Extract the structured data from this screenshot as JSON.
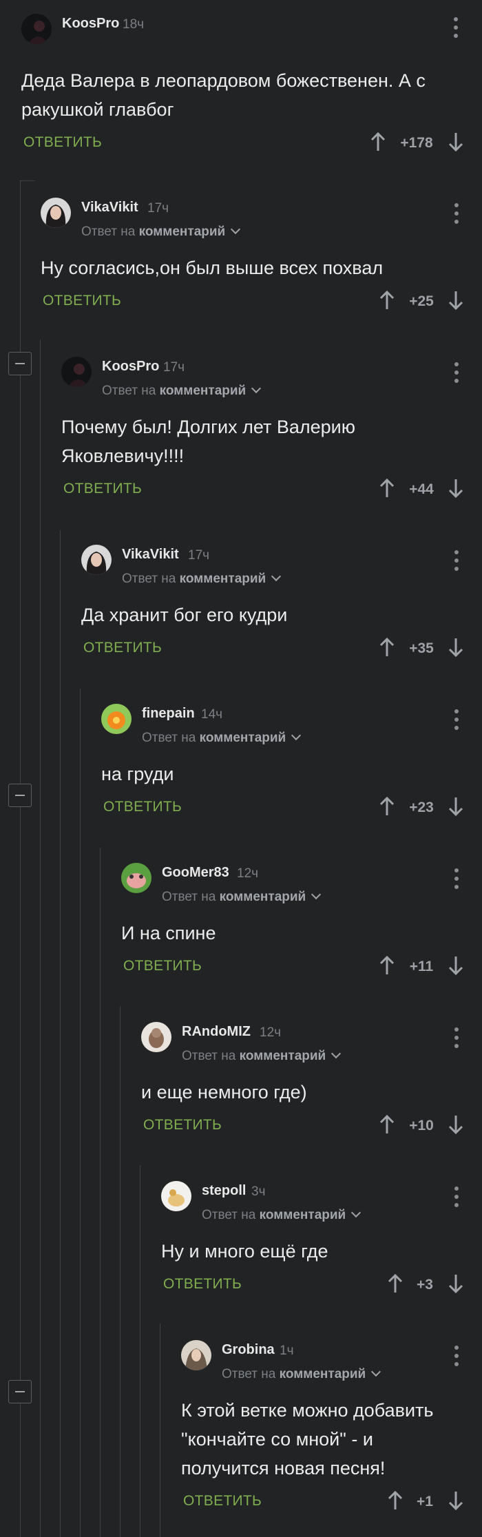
{
  "labels": {
    "answer": "ОТВЕТИТЬ",
    "reply_prefix": "Ответ на",
    "reply_target": "комментарий"
  },
  "comments": [
    {
      "user": "KoosPro",
      "time": "18ч",
      "text_lines": [
        "Деда Валера в леопардовом божественен. А с",
        "ракушкой главбог"
      ],
      "rating": "+178",
      "is_reply": false
    },
    {
      "user": "VikaVikit",
      "time": "17ч",
      "text_lines": [
        "Ну согласись,он был выше всех похвал"
      ],
      "rating": "+25",
      "is_reply": true
    },
    {
      "user": "KoosPro",
      "time": "17ч",
      "text_lines": [
        "Почему был! Долгих лет Валерию",
        "Яковлевичу!!!!"
      ],
      "rating": "+44",
      "is_reply": true
    },
    {
      "user": "VikaVikit",
      "time": "17ч",
      "text_lines": [
        "Да хранит бог его кудри"
      ],
      "rating": "+35",
      "is_reply": true
    },
    {
      "user": "finepain",
      "time": "14ч",
      "text_lines": [
        "на груди"
      ],
      "rating": "+23",
      "is_reply": true
    },
    {
      "user": "GooMer83",
      "time": "12ч",
      "text_lines": [
        "И на спине"
      ],
      "rating": "+11",
      "is_reply": true
    },
    {
      "user": "RAndoMIZ",
      "time": "12ч",
      "text_lines": [
        "и еще немного где)"
      ],
      "rating": "+10",
      "is_reply": true
    },
    {
      "user": "stepoll",
      "time": "3ч",
      "text_lines": [
        "Ну и много ещё где"
      ],
      "rating": "+3",
      "is_reply": true
    },
    {
      "user": "Grobina",
      "time": "1ч",
      "text_lines": [
        "К этой ветке можно добавить",
        "\"кончайте со мной\" - и",
        "получится новая песня!"
      ],
      "rating": "+1",
      "is_reply": true
    }
  ],
  "icons": {
    "upvote": "arrow-up-icon",
    "downvote": "arrow-down-icon",
    "menu": "more-vertical-icon",
    "collapse": "minus-collapse-icon",
    "expand": "chevron-down-icon"
  },
  "colors": {
    "background": "#212325",
    "answer_green": "#7fae4f",
    "thread_line": "#3f4245",
    "muted_text": "#7c8085"
  }
}
